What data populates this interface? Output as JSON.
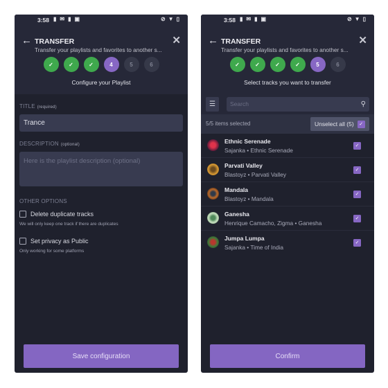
{
  "status_bar": {
    "time": "3:58"
  },
  "left": {
    "header": {
      "title": "TRANSFER",
      "subtitle": "Transfer your playlists and favorites to another s...",
      "steps": [
        {
          "label": "✓",
          "state": "done"
        },
        {
          "label": "✓",
          "state": "done"
        },
        {
          "label": "✓",
          "state": "done"
        },
        {
          "label": "4",
          "state": "current"
        },
        {
          "label": "5",
          "state": "todo"
        },
        {
          "label": "6",
          "state": "todo"
        }
      ],
      "caption": "Configure your Playlist"
    },
    "form": {
      "title_label": "TITLE",
      "title_hint": "(required)",
      "title_value": "Trance",
      "description_label": "DESCRIPTION",
      "description_hint": "(optional)",
      "description_placeholder": "Here is the playlist description (optional)",
      "other_options_label": "OTHER OPTIONS",
      "options": [
        {
          "label": "Delete duplicate tracks",
          "help": "We will only keep one track if there are duplicates",
          "checked": false
        },
        {
          "label": "Set privacy as Public",
          "help": "Only working for some platforms",
          "checked": false
        }
      ]
    },
    "button_label": "Save configuration"
  },
  "right": {
    "header": {
      "title": "TRANSFER",
      "subtitle": "Transfer your playlists and favorites to another s...",
      "steps": [
        {
          "label": "✓",
          "state": "done"
        },
        {
          "label": "✓",
          "state": "done"
        },
        {
          "label": "✓",
          "state": "done"
        },
        {
          "label": "✓",
          "state": "done"
        },
        {
          "label": "5",
          "state": "current"
        },
        {
          "label": "6",
          "state": "todo"
        }
      ],
      "caption": "Select tracks you want to transfer"
    },
    "search_placeholder": "Search",
    "selected_count": "5/5 items selected",
    "unselect_label": "Unselect all (5)",
    "tracks": [
      {
        "title": "Ethnic Serenade",
        "subtitle": "Sajanka • Ethnic Serenade",
        "checked": true
      },
      {
        "title": "Parvati Valley",
        "subtitle": "Blastoyz • Parvati Valley",
        "checked": true
      },
      {
        "title": "Mandala",
        "subtitle": "Blastoyz • Mandala",
        "checked": true
      },
      {
        "title": "Ganesha",
        "subtitle": "Henrique Camacho, Zigma • Ganesha",
        "checked": true
      },
      {
        "title": "Jumpa Lumpa",
        "subtitle": "Sajanka • Time of India",
        "checked": true
      }
    ],
    "button_label": "Confirm"
  },
  "colors": {
    "accent": "#8767c4",
    "done": "#3fa94d",
    "background": "#1f212d"
  }
}
